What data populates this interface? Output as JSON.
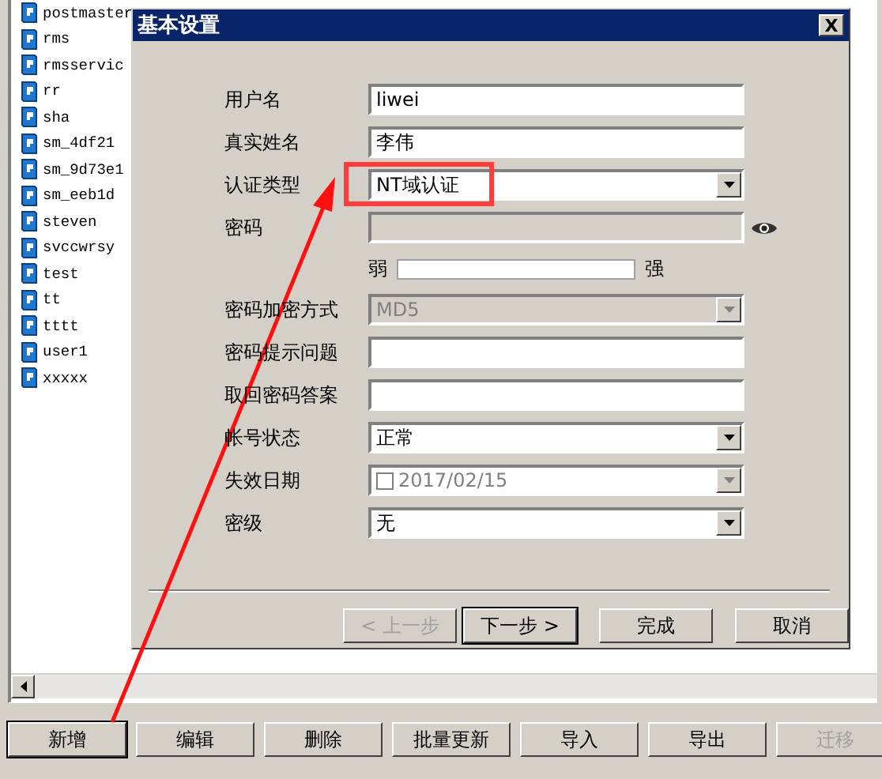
{
  "user_list": [
    {
      "name": "postmaster"
    },
    {
      "name": "rms"
    },
    {
      "name": "rmsservic"
    },
    {
      "name": "rr"
    },
    {
      "name": "sha"
    },
    {
      "name": "sm_4df21"
    },
    {
      "name": "sm_9d73e1"
    },
    {
      "name": "sm_eeb1d"
    },
    {
      "name": "steven"
    },
    {
      "name": "svccwrsy"
    },
    {
      "name": "test"
    },
    {
      "name": "tt"
    },
    {
      "name": "tttt"
    },
    {
      "name": "user1"
    },
    {
      "name": "xxxxx"
    }
  ],
  "dialog": {
    "title": "基本设置",
    "close": "X",
    "fields": [
      {
        "label": "用户名",
        "kind": "text",
        "value": "liwei"
      },
      {
        "label": "真实姓名",
        "kind": "text",
        "value": "李伟"
      },
      {
        "label": "认证类型",
        "kind": "select",
        "value": "NT域认证",
        "disabled": false
      },
      {
        "label": "密码",
        "kind": "password",
        "disabled": true
      },
      {
        "kind": "strength",
        "weak": "弱",
        "strong": "强",
        "level": 0
      },
      {
        "label": "密码加密方式",
        "kind": "select",
        "value": "MD5",
        "disabled": true
      },
      {
        "label": "密码提示问题",
        "kind": "text"
      },
      {
        "label": "取回密码答案",
        "kind": "text"
      },
      {
        "label": "帐号状态",
        "kind": "select",
        "value": "正常",
        "disabled": false
      },
      {
        "label": "失效日期",
        "kind": "date",
        "value": "2017/02/15",
        "checked": false,
        "disabled": true
      },
      {
        "label": "密级",
        "kind": "select",
        "value": "无",
        "disabled": false
      }
    ],
    "buttons": [
      {
        "label": "< 上一步",
        "disabled": true,
        "default": false
      },
      {
        "label": "下一步 >",
        "disabled": false,
        "default": true
      },
      {
        "label": "完成",
        "disabled": false,
        "default": false
      },
      {
        "label": "取消",
        "disabled": false,
        "default": false
      }
    ]
  },
  "toolbar": [
    {
      "label": "新增",
      "disabled": false,
      "default": true
    },
    {
      "label": "编辑",
      "disabled": false,
      "default": false
    },
    {
      "label": "删除",
      "disabled": false,
      "default": false
    },
    {
      "label": "批量更新",
      "disabled": false,
      "default": false
    },
    {
      "label": "导入",
      "disabled": false,
      "default": false
    },
    {
      "label": "导出",
      "disabled": false,
      "default": false
    },
    {
      "label": "迁移",
      "disabled": true,
      "default": false
    }
  ]
}
